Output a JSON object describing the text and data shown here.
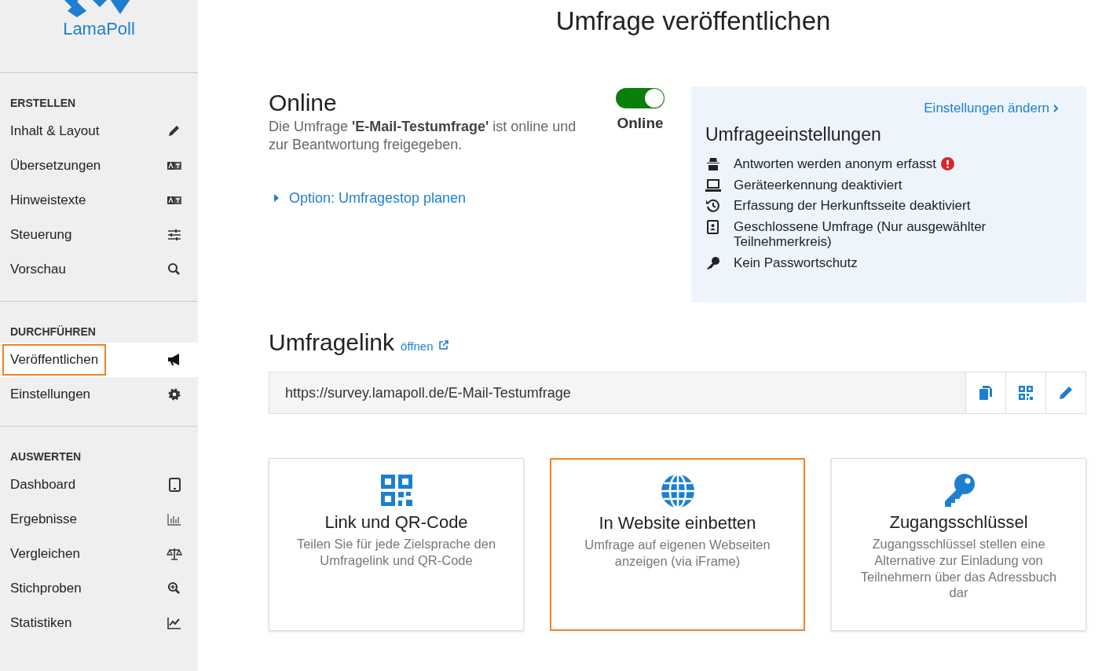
{
  "logo": {
    "name": "LamaPoll"
  },
  "sidebar": {
    "sections": [
      {
        "heading": "ERSTELLEN",
        "items": [
          {
            "label": "Inhalt & Layout",
            "selected": false,
            "highlighted": false
          },
          {
            "label": "Übersetzungen",
            "selected": false,
            "highlighted": false
          },
          {
            "label": "Hinweistexte",
            "selected": false,
            "highlighted": false
          },
          {
            "label": "Steuerung",
            "selected": false,
            "highlighted": false
          },
          {
            "label": "Vorschau",
            "selected": false,
            "highlighted": false
          }
        ]
      },
      {
        "heading": "DURCHFÜHREN",
        "items": [
          {
            "label": "Veröffentlichen",
            "selected": true,
            "highlighted": true
          },
          {
            "label": "Einstellungen",
            "selected": false,
            "highlighted": false
          }
        ]
      },
      {
        "heading": "AUSWERTEN",
        "items": [
          {
            "label": "Dashboard",
            "selected": false,
            "highlighted": false
          },
          {
            "label": "Ergebnisse",
            "selected": false,
            "highlighted": false
          },
          {
            "label": "Vergleichen",
            "selected": false,
            "highlighted": false
          },
          {
            "label": "Stichproben",
            "selected": false,
            "highlighted": false
          },
          {
            "label": "Statistiken",
            "selected": false,
            "highlighted": false
          }
        ]
      }
    ]
  },
  "page_title": "Umfrage veröffentlichen",
  "status": {
    "heading": "Online",
    "description": "Die Umfrage **'E-Mail-Testumfrage'** ist online und zur Beantwortung freigegeben.",
    "toggle_on": true,
    "toggle_label": "Online",
    "option_link": "Option: Umfragestop planen"
  },
  "settings_panel": {
    "edit_link": "Einstellungen ändern",
    "heading": "Umfrageeinstellungen",
    "items": [
      {
        "text": "Antworten werden anonym erfasst",
        "warning": true
      },
      {
        "text": "Geräteerkennung deaktiviert",
        "warning": false
      },
      {
        "text": "Erfassung der Herkunftsseite deaktiviert",
        "warning": false
      },
      {
        "text": "Geschlossene Umfrage (Nur ausgewählter Teilnehmerkreis)",
        "warning": false
      },
      {
        "text": "Kein Passwortschutz",
        "warning": false
      }
    ]
  },
  "survey_link": {
    "heading": "Umfragelink",
    "open_link": "öffnen",
    "url": "https://survey.lamapoll.de/E-Mail-Testumfrage"
  },
  "cards": [
    {
      "title": "Link und QR-Code",
      "description": "Teilen Sie für jede Zielsprache den Umfragelink und QR-Code",
      "highlighted": false
    },
    {
      "title": "In Website einbetten",
      "description": "Umfrage auf eigenen Webseiten anzeigen (via iFrame)",
      "highlighted": true
    },
    {
      "title": "Zugangsschlüssel",
      "description": "Zugangsschlüssel stellen eine Alternative zur Einladung von Teilnehmern über das Adressbuch dar",
      "highlighted": false
    }
  ]
}
